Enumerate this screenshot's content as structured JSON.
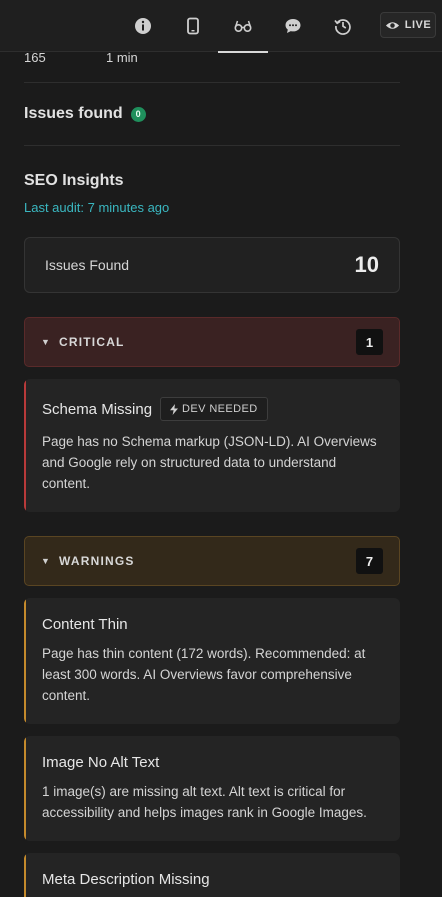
{
  "toolbar": {
    "tabs": [
      {
        "name": "info",
        "icon": "info-icon"
      },
      {
        "name": "mobile",
        "icon": "mobile-icon"
      },
      {
        "name": "seo",
        "icon": "glasses-icon",
        "active": true
      },
      {
        "name": "comments",
        "icon": "chat-icon"
      },
      {
        "name": "history",
        "icon": "history-icon"
      }
    ],
    "live_label": "LIVE"
  },
  "stats": {
    "left": "165",
    "right": "1 min"
  },
  "issues_found_header": {
    "title": "Issues found",
    "count": "0"
  },
  "seo": {
    "title": "SEO Insights",
    "last_audit": "Last audit: 7 minutes ago",
    "summary_label": "Issues Found",
    "summary_value": "10"
  },
  "groups": {
    "critical": {
      "label": "CRITICAL",
      "count": "1",
      "issues": [
        {
          "title": "Schema Missing",
          "tag": "DEV NEEDED",
          "description": "Page has no Schema markup (JSON-LD). AI Overviews and Google rely on structured data to understand content."
        }
      ]
    },
    "warnings": {
      "label": "WARNINGS",
      "count": "7",
      "issues": [
        {
          "title": "Content Thin",
          "description": "Page has thin content (172 words). Recommended: at least 300 words. AI Overviews favor comprehensive content."
        },
        {
          "title": "Image No Alt Text",
          "description": "1 image(s) are missing alt text. Alt text is critical for accessibility and helps images rank in Google Images."
        },
        {
          "title": "Meta Description Missing",
          "description": ""
        }
      ]
    }
  },
  "colors": {
    "accent_teal": "#3ab7c0",
    "critical_red": "#b83a3a",
    "warning_amber": "#c48a2c",
    "badge_green": "#1f8f5c"
  }
}
